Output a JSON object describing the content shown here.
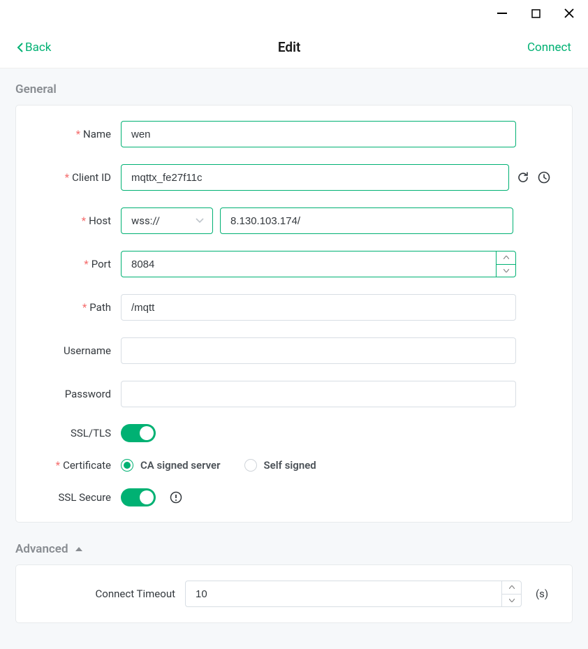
{
  "header": {
    "back_label": "Back",
    "title": "Edit",
    "connect_label": "Connect"
  },
  "sections": {
    "general_title": "General",
    "advanced_title": "Advanced"
  },
  "labels": {
    "name": "Name",
    "client_id": "Client ID",
    "host": "Host",
    "port": "Port",
    "path": "Path",
    "username": "Username",
    "password": "Password",
    "ssl_tls": "SSL/TLS",
    "certificate": "Certificate",
    "ssl_secure": "SSL Secure",
    "connect_timeout": "Connect Timeout"
  },
  "values": {
    "name": "wen",
    "client_id": "mqttx_fe27f11c",
    "protocol": "wss://",
    "host": "8.130.103.174/",
    "port": "8084",
    "path": "/mqtt",
    "username": "",
    "password": "",
    "ssl_tls_on": true,
    "ssl_secure_on": true,
    "connect_timeout": "10"
  },
  "certificate": {
    "option_ca": "CA signed server",
    "option_self": "Self signed",
    "selected": "ca"
  },
  "units": {
    "seconds": "(s)"
  }
}
